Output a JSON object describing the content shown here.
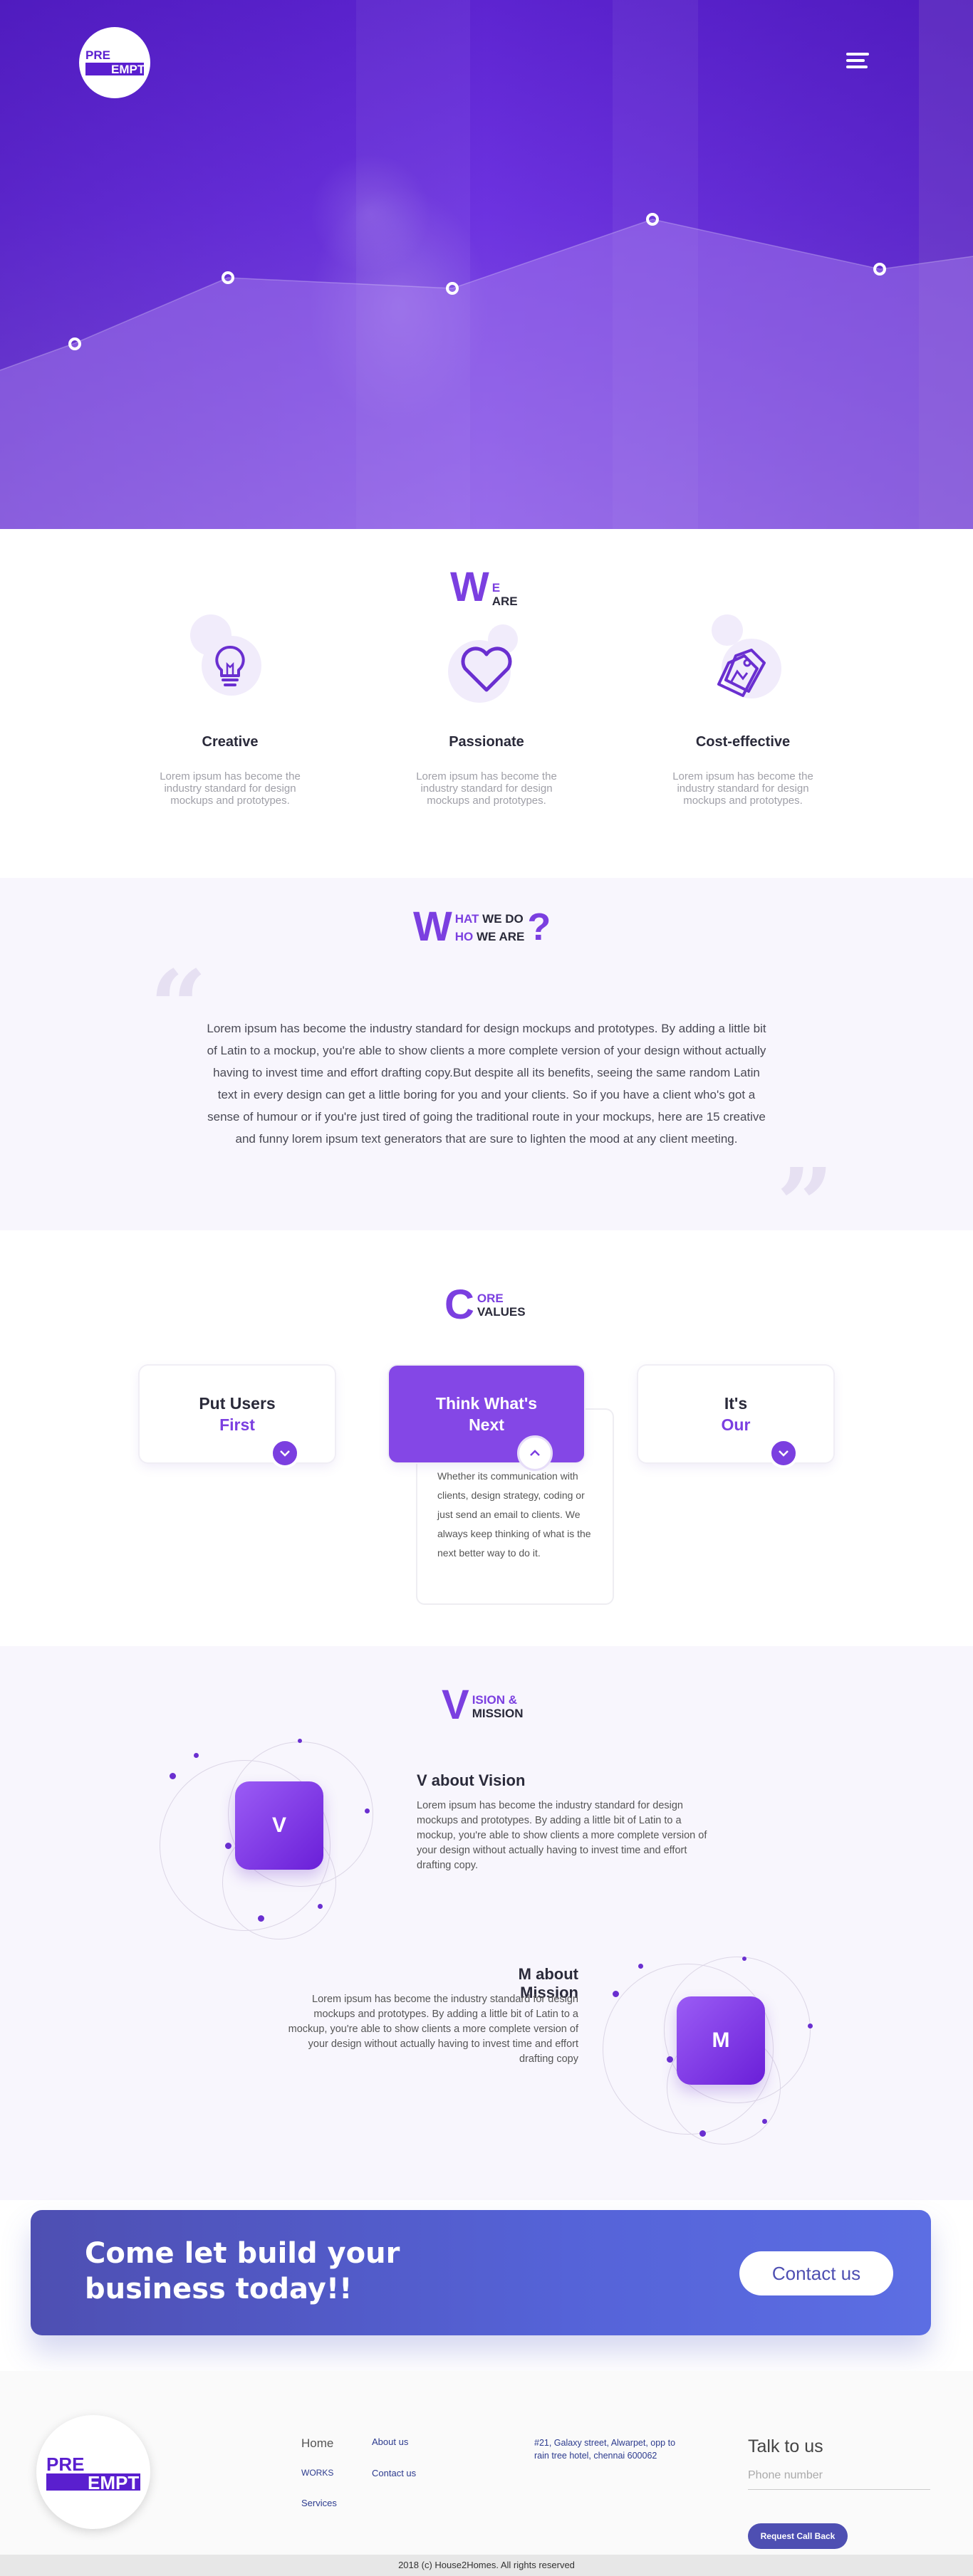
{
  "logo": {
    "line1": "PRE",
    "line2": "EMPT"
  },
  "weare": {
    "title_big": "W",
    "title_top": "E",
    "title_bottom": "ARE",
    "features": [
      {
        "icon": "lightbulb-icon",
        "title": "Creative",
        "text": "Lorem ipsum has become the industry standard for design mockups and prototypes."
      },
      {
        "icon": "heart-icon",
        "title": "Passionate",
        "text": "Lorem ipsum has become the industry standard for design mockups and prototypes."
      },
      {
        "icon": "price-tag-icon",
        "title": "Cost-effective",
        "text": "Lorem ipsum has become the industry standard for design mockups and prototypes."
      }
    ]
  },
  "whatwedo": {
    "title_big": "W",
    "line1_a": "HAT",
    "line1_b": " WE DO",
    "line2_a": "HO",
    "line2_b": " WE ARE",
    "question": "?",
    "body": "Lorem ipsum has become the industry standard for design mockups and prototypes. By adding a little bit of Latin to a mockup, you're able to show clients a more complete version of your design without actually having to invest time and effort drafting copy.But despite all its benefits, seeing the same random Latin text in every design can get a little boring for you and your clients. So if you have a client who's got a sense of humour or if you're just tired of going the traditional route in your mockups, here are 15 creative and funny lorem ipsum text generators that are sure to lighten the mood at any client meeting."
  },
  "core": {
    "title_big": "C",
    "title_top": "ORE",
    "title_bottom": "VALUES",
    "cards": [
      {
        "line1": "Put Users",
        "line2": "First"
      },
      {
        "line1": "Think What's",
        "line2": "Next"
      },
      {
        "line1": "It's",
        "line2": "Our"
      }
    ],
    "expanded_text": "Whether its communication with clients, design strategy, coding or just send an email to clients. We always keep thinking of what is the next better way to do it."
  },
  "vm": {
    "title_big": "V",
    "title_top": "ISION &",
    "title_bottom": "MISSION",
    "vision": {
      "tile": "V",
      "heading": "V about Vision",
      "text": "Lorem ipsum has become the industry standard for design mockups and prototypes. By adding a little bit of Latin to a mockup, you're able to show clients a more complete version of your design without actually having to invest time and effort drafting copy."
    },
    "mission": {
      "tile": "M",
      "heading": "M about Mission",
      "text": "Lorem ipsum has become the industry standard for design mockups and prototypes. By adding a little bit of Latin to a mockup, you're able to show clients a more complete version of your design without actually having to invest time and effort drafting copy"
    }
  },
  "cta": {
    "heading": "Come let build your business today!!",
    "button": "Contact us"
  },
  "footer": {
    "links_col1": [
      "Home",
      "WORKS",
      "Services"
    ],
    "links_col2": [
      "About us",
      "Contact us"
    ],
    "address": "#21, Galaxy street, Alwarpet, opp to rain tree hotel, chennai 600062",
    "talk": "Talk to us",
    "phone_placeholder": "Phone number",
    "callback": "Request Call Back",
    "copyright": "2018 (c) House2Homes. All rights reserved"
  },
  "colors": {
    "primary": "#7b3fe0",
    "cta": "#4e4fb2",
    "hero": "#5a1fcf"
  }
}
